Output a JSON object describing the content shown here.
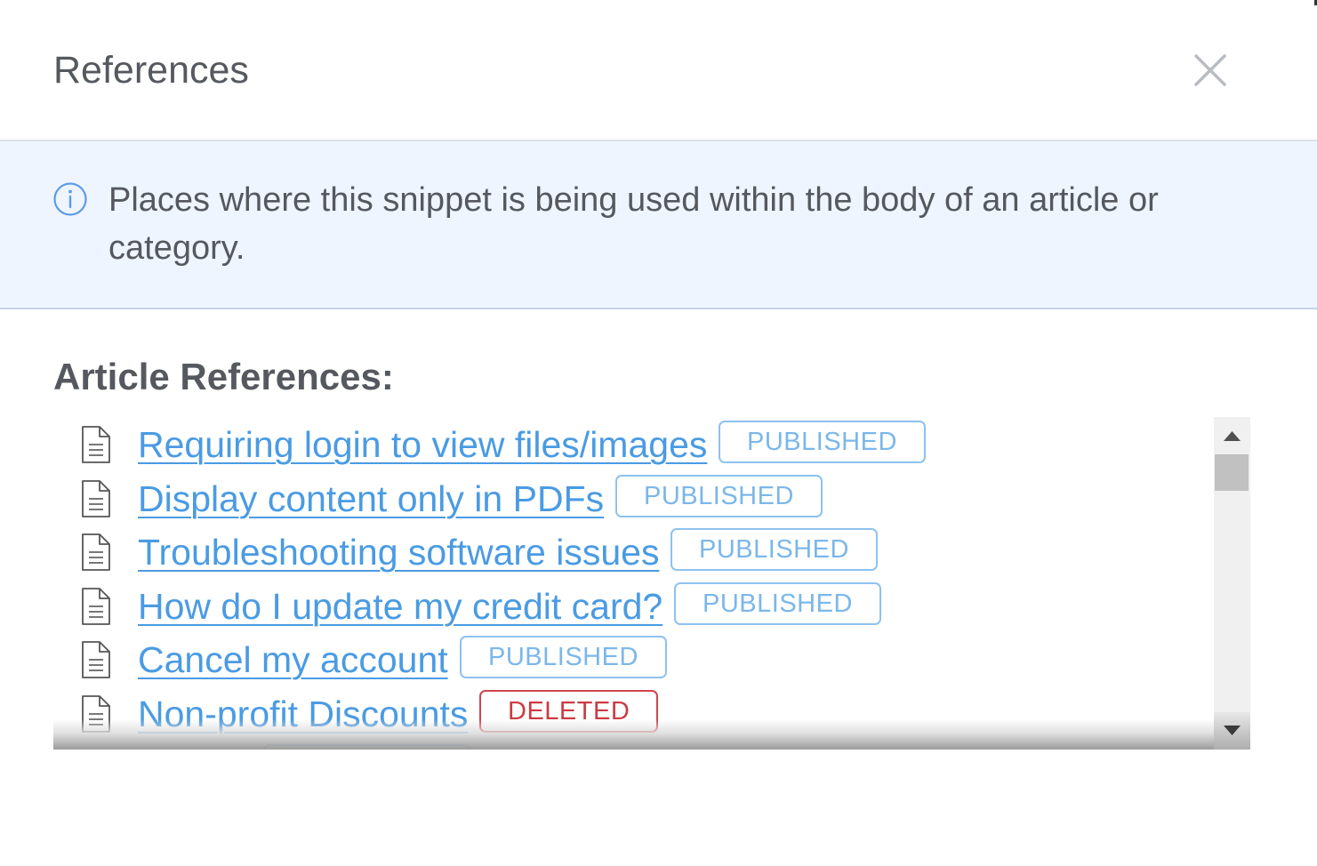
{
  "header": {
    "title": "References",
    "close_icon": "close-icon"
  },
  "info": {
    "icon": "info-icon",
    "text": "Places where this snippet is being used within the body of an article or category."
  },
  "article_references": {
    "heading": "Article References:",
    "items": [
      {
        "title": "Requiring login to view files/images",
        "status": "PUBLISHED"
      },
      {
        "title": "Display content only in PDFs",
        "status": "PUBLISHED"
      },
      {
        "title": "Troubleshooting software issues",
        "status": "PUBLISHED"
      },
      {
        "title": "How do I update my credit card?",
        "status": "PUBLISHED"
      },
      {
        "title": "Cancel my account",
        "status": "PUBLISHED"
      },
      {
        "title": "Non-profit Discounts",
        "status": "DELETED"
      }
    ]
  },
  "colors": {
    "link": "#4a9be3",
    "published": "#7bb7ea",
    "deleted": "#cc3b43",
    "banner_bg": "#eff5fe"
  }
}
